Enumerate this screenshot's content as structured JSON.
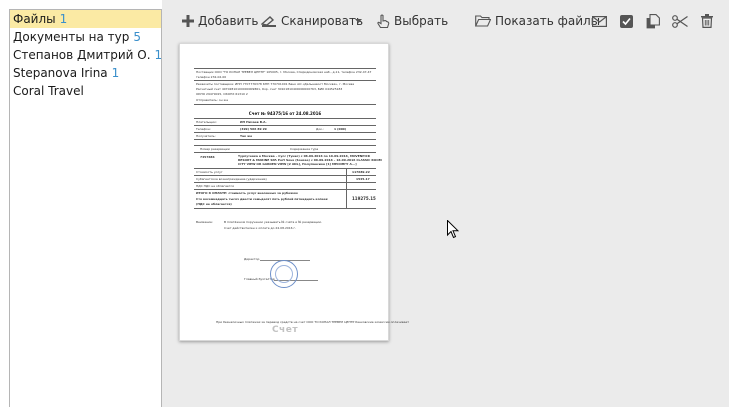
{
  "sidebar": {
    "items": [
      {
        "label": "Файлы",
        "count": "1",
        "selected": true
      },
      {
        "label": "Документы на тур",
        "count": "5"
      },
      {
        "label": "Степанов Дмитрий О.",
        "count": "1"
      },
      {
        "label": "Stepanova Irina",
        "count": "1"
      },
      {
        "label": "Coral Travel",
        "count": ""
      }
    ]
  },
  "toolbar": {
    "add_label": "Добавить",
    "scan_label": "Сканировать",
    "select_label": "Выбрать",
    "show_files_label": "Показать файлы"
  },
  "document": {
    "header_line1": "Поставщик ООО \"ТО КОНАЛ ТРЕВЕЛ ЦЕНТР\" 105005, г. Москва, Спиридоновская наб., д.11, телефон 232-47-47",
    "header_line2": "телефон 232-02-00",
    "bank_line1": "Реквизиты поставщика: ИНН 7707776378 КПП 770701001 Банк АО «Дальневост Москва», г. Москва",
    "bank_line2": "Расчетный счет 40702810100000009861, Кор. счет 30101810400000000763, БИК 044525183",
    "bank_line3": "ОКПО 29479015, ОКОНХ 61310 2",
    "bank_line4": "Отправитель: он же",
    "title": "Счет № 94375/16 от 24.08.2016",
    "payer_label": "Плательщик:",
    "payer_value": "ИП Ничаев В.А.",
    "phone_label": "Телефон:",
    "phone_value": "(499) 566 89 29",
    "doc_label": "Док.:",
    "doc_value": "1 (000)",
    "receiver_label": "Получатель:",
    "receiver_value": "Так же",
    "col_booking": "Номер резервации",
    "col_content": "Содержание тура",
    "booking_number": "7457686",
    "tour_line1": "Турпутевка в Москва – Сусс (Тунис) с 06.09.2016 по 16.09.2016, MOVENPICK",
    "tour_line2": "RESORT & MARINE SPA Port Sous (Sousse) с 06.09.2016 – 16.09.2016 CLASSIC ROOM",
    "tour_line3": "CITY VIEW OR GARDEN VIEW [2 ADL], Полупансион [1] МЕСИНГУ А...]",
    "cost_label": "Стоимость услуг",
    "cost_value": "117689.22",
    "agent_fee_label": "Субагентское вознаграждение (удержание)",
    "agent_fee_value": "1545.17",
    "vat_label": "НДС НДС не облагается",
    "total_label": "ИТОГО К ОПЛАТЕ: стоимость услуг внесенных за рубежом",
    "total_sub": "Сто восемнадцать тысяч двести семьдесят пять рублей пятнадцать копеек",
    "total_sub2": "(НДС не облагается)",
    "total_value": "119275.15",
    "note_label": "Внимание:",
    "note_line1": "В платёжном поручении указывать № счёта и № резервации.",
    "note_line2": "Счет действителен к оплате до 24.08.2016 г.",
    "sign1": "Директор",
    "sign2": "Главный бухгалтер",
    "footer": "При безналичных платежах за перевод средств на счет ООО ТО КОНАЛ ТРЕВЕЛ ЦЕНТР банковские комиссии оплачивает",
    "watermark": "Счет"
  }
}
